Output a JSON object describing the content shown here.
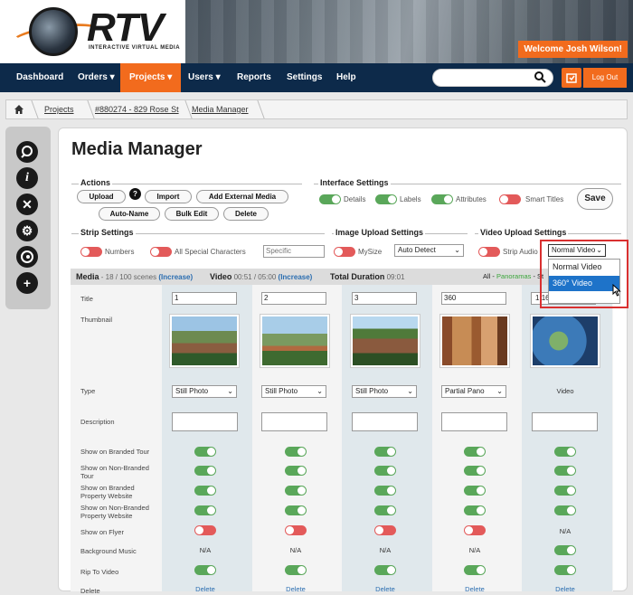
{
  "brand": {
    "name": "RTV",
    "tagline": "INTERACTIVE VIRTUAL MEDIA"
  },
  "welcome": "Welcome Josh Wilson!",
  "nav": {
    "items": [
      "Dashboard",
      "Orders",
      "Projects",
      "Users",
      "Reports",
      "Settings",
      "Help"
    ],
    "logout": "Log Out"
  },
  "breadcrumb": [
    "Projects",
    "#880274 - 829 Rose St",
    "Media Manager"
  ],
  "page_title": "Media Manager",
  "actions": {
    "title": "Actions",
    "upload": "Upload",
    "help": "?",
    "import": "Import",
    "add_external": "Add External Media",
    "auto_name": "Auto-Name",
    "bulk_edit": "Bulk Edit",
    "delete": "Delete"
  },
  "interface": {
    "title": "Interface Settings",
    "details": "Details",
    "labels": "Labels",
    "attributes": "Attributes",
    "smart_titles": "Smart Titles",
    "save": "Save"
  },
  "strip": {
    "title": "Strip Settings",
    "numbers": "Numbers",
    "special_chars": "All Special Characters",
    "specific_char_placeholder": "Specific Character"
  },
  "image_upload": {
    "title": "Image Upload Settings",
    "mysize": "MySize",
    "mode": "Auto Detect"
  },
  "video_upload": {
    "title": "Video Upload Settings",
    "strip_audio": "Strip Audio",
    "selected": "Normal Video",
    "options": [
      "Normal Video",
      "360° Video"
    ]
  },
  "media_bar": {
    "label": "Media",
    "scenes": "- 18 / 100 scenes",
    "increase1": "(Increase)",
    "video_label": "Video",
    "video_time": "00:51 / 05:00",
    "increase2": "(Increase)",
    "total_label": "Total Duration",
    "total_time": "09:01",
    "filter_all": "All -",
    "filter_panoramas": "Panoramas",
    "filter_rest": "- St"
  },
  "row_labels": {
    "title": "Title",
    "thumbnail": "Thumbnail",
    "type": "Type",
    "description": "Description",
    "branded": "Show on Branded Tour",
    "nonbranded": "Show on Non-Branded Tour",
    "branded_web": "Show on Branded Property Website",
    "nonbranded_web": "Show on Non-Branded Property Website",
    "flyer": "Show on Flyer",
    "music": "Background Music",
    "rip": "Rip To Video",
    "delete": "Delete"
  },
  "columns": [
    {
      "title": "1",
      "type": "Still Photo",
      "music": "N/A",
      "flyer_on": false,
      "delete": "Delete"
    },
    {
      "title": "2",
      "type": "Still Photo",
      "music": "N/A",
      "flyer_on": false,
      "delete": "Delete"
    },
    {
      "title": "3",
      "type": "Still Photo",
      "music": "N/A",
      "flyer_on": false,
      "delete": "Delete"
    },
    {
      "title": "360",
      "type": "Partial Pano",
      "music": "N/A",
      "flyer_on": false,
      "delete": "Delete"
    },
    {
      "title": "1649",
      "type": "Video",
      "music": "",
      "flyer_na": "N/A",
      "delete": "Delete"
    }
  ]
}
